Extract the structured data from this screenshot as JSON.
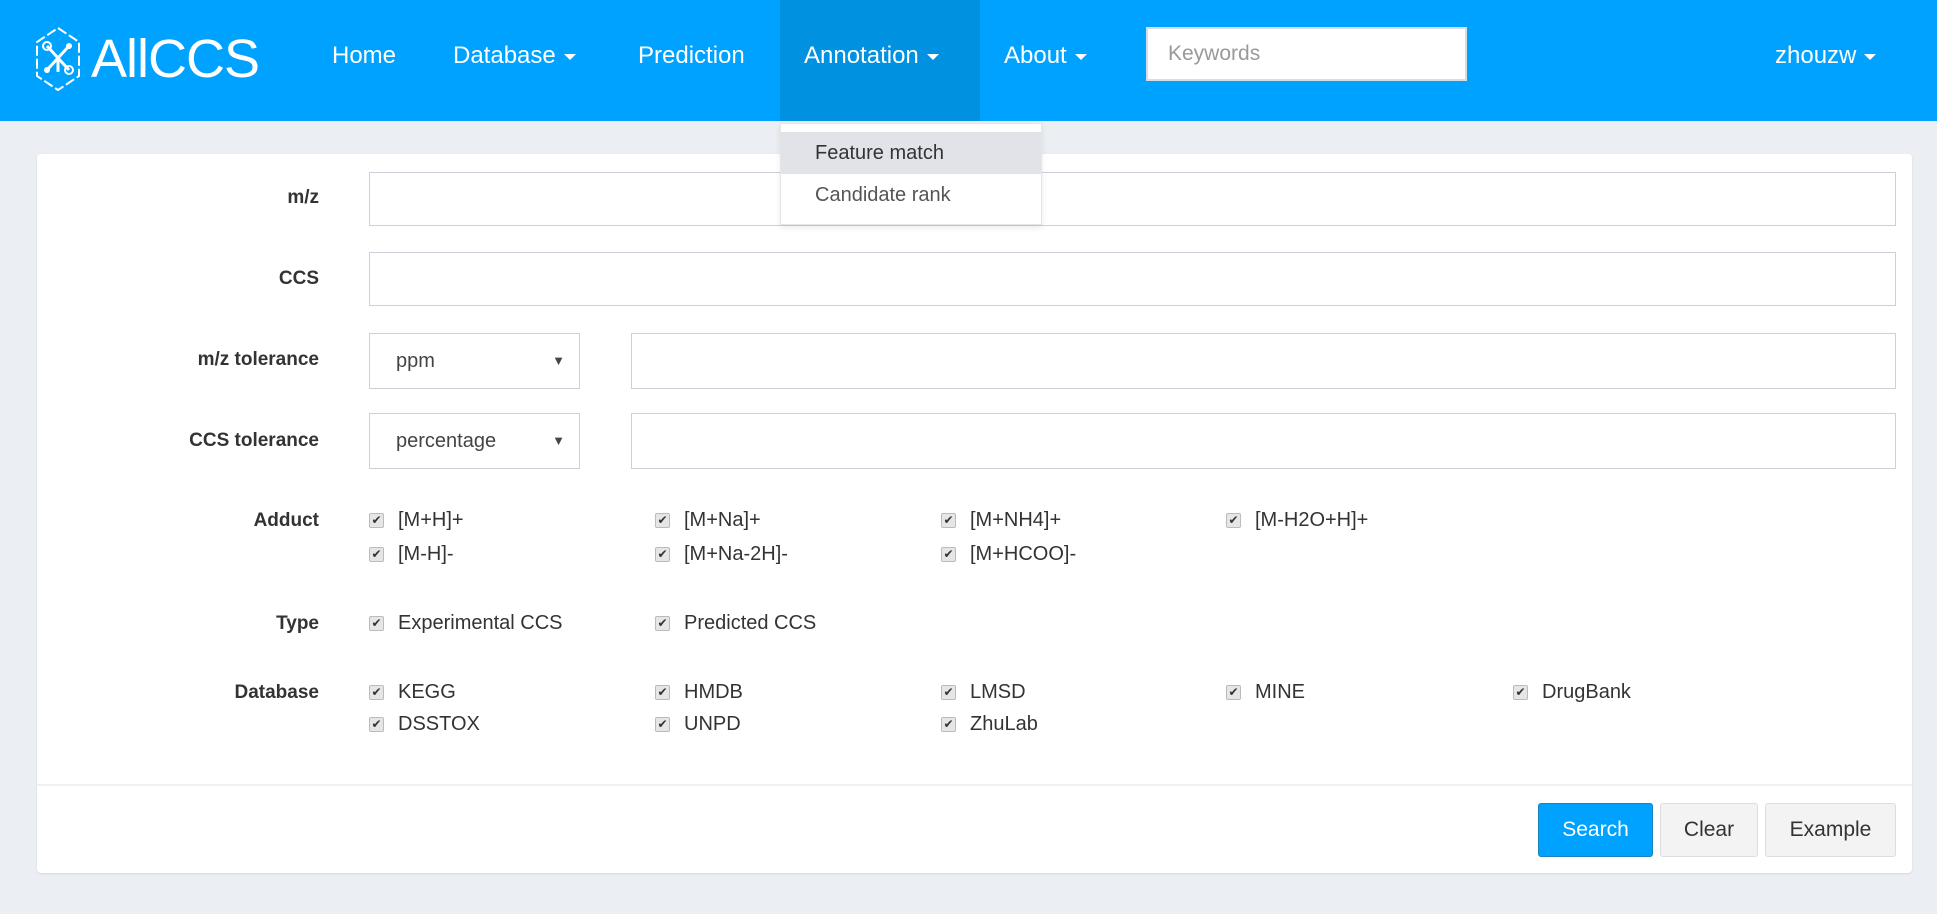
{
  "navbar": {
    "brand": "AllCCS",
    "items": [
      {
        "label": "Home",
        "dropdown": false
      },
      {
        "label": "Database",
        "dropdown": true
      },
      {
        "label": "Prediction",
        "dropdown": false
      },
      {
        "label": "Annotation",
        "dropdown": true,
        "active": true
      },
      {
        "label": "About",
        "dropdown": true
      }
    ],
    "search_placeholder": "Keywords",
    "user": "zhouzw"
  },
  "annotation_menu": [
    "Feature match",
    "Candidate rank"
  ],
  "form": {
    "mz_label": "m/z",
    "mz_value": "",
    "ccs_label": "CCS",
    "ccs_value": "",
    "mz_tol_label": "m/z tolerance",
    "mz_tol_unit": "ppm",
    "mz_tol_value": "",
    "ccs_tol_label": "CCS tolerance",
    "ccs_tol_unit": "percentage",
    "ccs_tol_value": "",
    "adduct_label": "Adduct",
    "adducts": [
      "[M+H]+",
      "[M+Na]+",
      "[M+NH4]+",
      "[M-H2O+H]+",
      "[M-H]-",
      "[M+Na-2H]-",
      "[M+HCOO]-"
    ],
    "type_label": "Type",
    "types": [
      "Experimental CCS",
      "Predicted CCS"
    ],
    "database_label": "Database",
    "databases": [
      "KEGG",
      "HMDB",
      "LMSD",
      "MINE",
      "DrugBank",
      "DSSTOX",
      "UNPD",
      "ZhuLab"
    ],
    "all_checked": true
  },
  "buttons": {
    "search": "Search",
    "clear": "Clear",
    "example": "Example"
  },
  "colors": {
    "primary": "#00a2ff",
    "active_nav": "#0091e0",
    "background": "#ebeef2"
  }
}
